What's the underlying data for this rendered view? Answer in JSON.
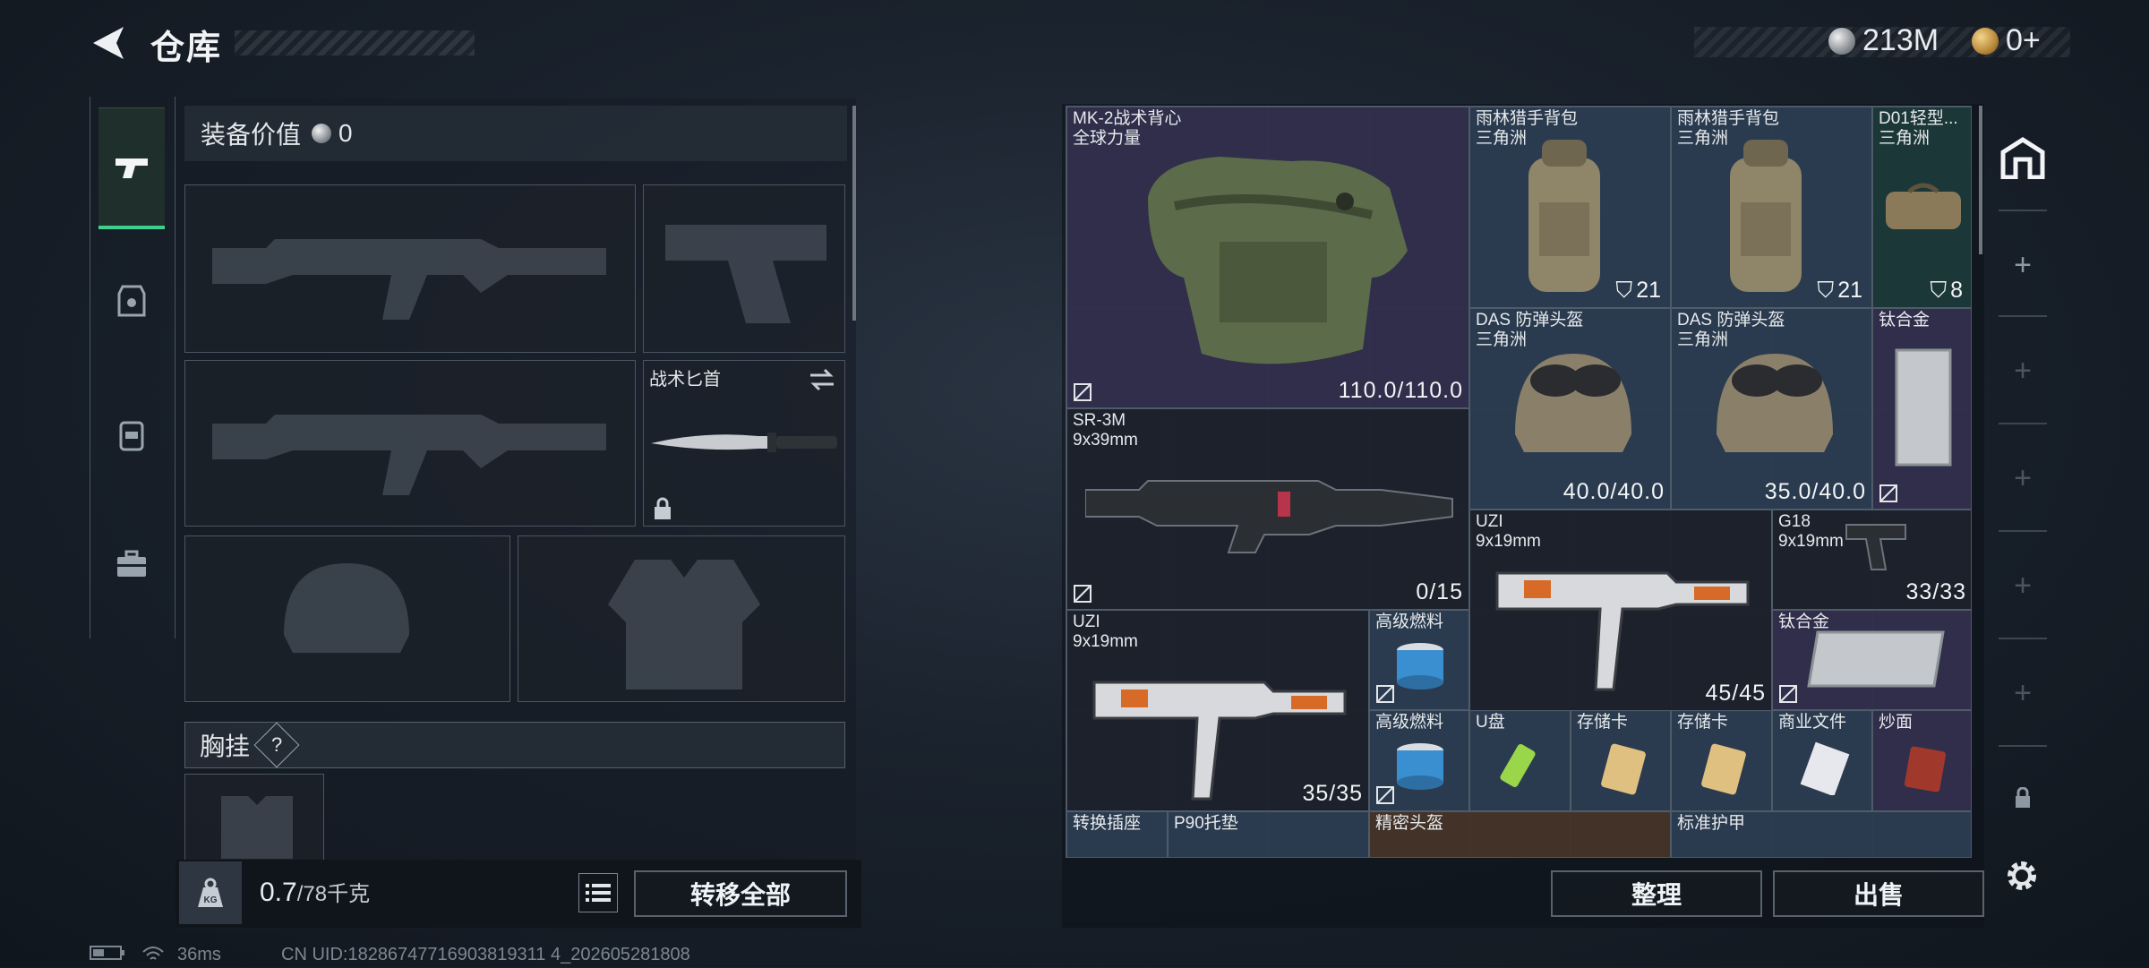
{
  "header": {
    "title": "仓库"
  },
  "currencies": [
    {
      "icon": "silver-coin-icon",
      "value": "213M"
    },
    {
      "icon": "gold-coin-icon",
      "value": "0+"
    }
  ],
  "loadout": {
    "value_label": "装备价值",
    "value": "0",
    "melee_label": "战术匕首",
    "chest_rig_label": "胸挂",
    "chest_rig_help": "?",
    "weight_value": "0.7",
    "weight_max": "/78千克",
    "transfer_all": "转移全部"
  },
  "stash": {
    "items": [
      {
        "id": "vest",
        "name": "MK-2战术背心",
        "sub": "全球力量",
        "value": "110.0/110.0"
      },
      {
        "id": "bag1",
        "name": "雨林猎手背包",
        "sub": "三角洲",
        "count": "21"
      },
      {
        "id": "bag2",
        "name": "雨林猎手背包",
        "sub": "三角洲",
        "count": "21"
      },
      {
        "id": "bag3",
        "name": "D01轻型...",
        "sub": "三角洲",
        "count": "8"
      },
      {
        "id": "helm1",
        "name": "DAS 防弹头盔",
        "sub": "三角洲",
        "value": "40.0/40.0"
      },
      {
        "id": "helm2",
        "name": "DAS 防弹头盔",
        "sub": "三角洲",
        "value": "35.0/40.0"
      },
      {
        "id": "ti1",
        "name": "钛合金"
      },
      {
        "id": "sr3m",
        "name": "SR-3M",
        "sub": "9x39mm",
        "value": "0/15"
      },
      {
        "id": "uzi1",
        "name": "UZI",
        "sub": "9x19mm",
        "value": "45/45"
      },
      {
        "id": "g18",
        "name": "G18",
        "sub": "9x19mm",
        "value": "33/33"
      },
      {
        "id": "uzi2",
        "name": "UZI",
        "sub": "9x19mm",
        "value": "35/35"
      },
      {
        "id": "fuel1",
        "name": "高级燃料"
      },
      {
        "id": "ti2",
        "name": "钛合金"
      },
      {
        "id": "fuel2",
        "name": "高级燃料"
      },
      {
        "id": "usb",
        "name": "U盘"
      },
      {
        "id": "card1",
        "name": "存储卡"
      },
      {
        "id": "card2",
        "name": "存储卡"
      },
      {
        "id": "docs",
        "name": "商业文件"
      },
      {
        "id": "noodle",
        "name": "炒面"
      },
      {
        "id": "socket",
        "name": "转换插座"
      },
      {
        "id": "p90pad",
        "name": "P90托垫"
      },
      {
        "id": "precisehelm",
        "name": "精密头盔"
      },
      {
        "id": "stdarmor",
        "name": "标准护甲"
      }
    ],
    "sort_button": "整理",
    "sell_button": "出售"
  },
  "status": {
    "ping": "36ms",
    "uid": "CN UID:18286747716903819311 4_202605281808"
  }
}
